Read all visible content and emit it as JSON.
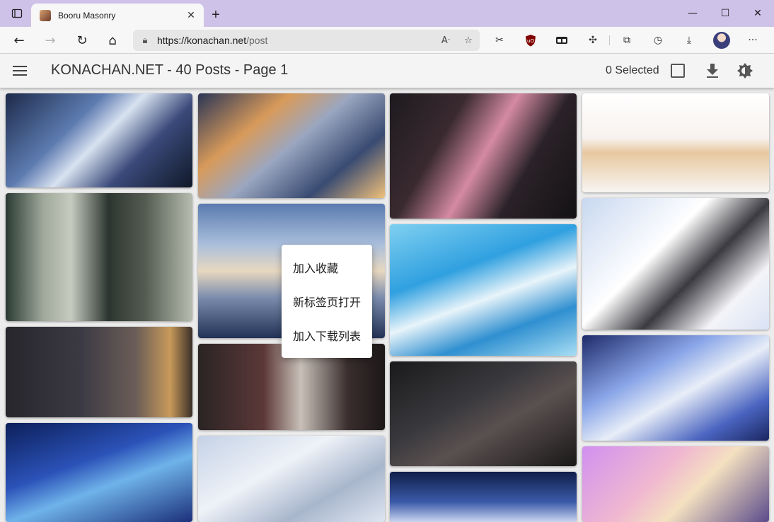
{
  "browser": {
    "tab_title": "Booru Masonry",
    "tab_close": "✕",
    "new_tab": "+",
    "window_buttons": {
      "minimize": "—",
      "maximize": "☐",
      "close": "✕"
    },
    "nav": {
      "back": "←",
      "forward": "→",
      "reload": "↻",
      "home": "⌂"
    },
    "url_host": "https://konachan.net",
    "url_path": "/post",
    "toolbar_more": "···"
  },
  "app": {
    "title": "KONACHAN.NET - 40 Posts - Page 1",
    "selected_text": "0 Selected"
  },
  "context_menu": {
    "items": [
      "加入收藏",
      "新标签页打开",
      "加入下载列表"
    ]
  },
  "colors": {
    "titlebar": "#cfc2e8",
    "appbar": "#f4f4f4",
    "page_bg": "#ececec"
  },
  "thumbnails": {
    "col1": [
      {
        "name": "anime-art-silver-haired-girl-blue-flames"
      },
      {
        "name": "anime-art-girl-braids-train-window"
      },
      {
        "name": "anime-art-night-street-cafe"
      },
      {
        "name": "anime-art-starry-sky-fairy"
      }
    ],
    "col2": [
      {
        "name": "anime-art-girl-hoodie-city-sunset"
      },
      {
        "name": "anime-art-sky-clouds-sea"
      },
      {
        "name": "anime-art-girl-red-room-desk"
      },
      {
        "name": "anime-art-white-haired-girl-snow"
      }
    ],
    "col3": [
      {
        "name": "anime-art-pink-haired-girl-katana"
      },
      {
        "name": "anime-art-girl-underwater-fish"
      },
      {
        "name": "anime-art-girl-dark-hall-lights"
      },
      {
        "name": "anime-art-girl-moonlight-blue"
      }
    ],
    "col4": [
      {
        "name": "anime-art-girl-sleeping-white"
      },
      {
        "name": "anime-art-girl-gray-hair-star-pillow"
      },
      {
        "name": "anime-art-twin-girls-blue-flowers"
      },
      {
        "name": "anime-art-blonde-girl-car-sunset"
      }
    ]
  }
}
